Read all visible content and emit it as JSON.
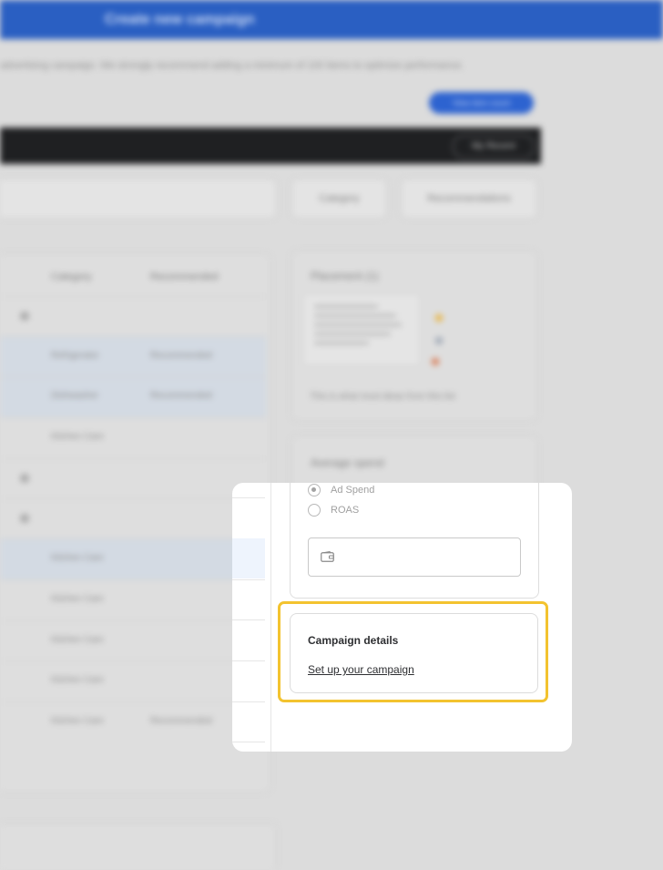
{
  "header": {
    "title": "Create new campaign"
  },
  "intro_text": "advertising campaign. We strongly recommend adding a minimum of 100 items to optimize performance.",
  "help_button": "View item count",
  "toolbar": {
    "button_label": "My Recent"
  },
  "filters": {
    "category": "Category",
    "recommendations": "Recommendations"
  },
  "table": {
    "headers": [
      "Category",
      "Recommended"
    ],
    "rows": [
      {
        "category": "",
        "recommended": "",
        "highlighted": false
      },
      {
        "category": "Refrigerator",
        "recommended": "Recommended",
        "highlighted": true
      },
      {
        "category": "Dishwasher",
        "recommended": "Recommended",
        "highlighted": true
      },
      {
        "category": "Kitchen Care",
        "recommended": "",
        "highlighted": false
      },
      {
        "category": "",
        "recommended": "",
        "highlighted": false
      },
      {
        "category": "",
        "recommended": "",
        "highlighted": false
      },
      {
        "category": "Kitchen Care",
        "recommended": "",
        "highlighted": true
      },
      {
        "category": "Kitchen Care",
        "recommended": "",
        "highlighted": false
      },
      {
        "category": "Kitchen Care",
        "recommended": "",
        "highlighted": false
      },
      {
        "category": "Kitchen Care",
        "recommended": "",
        "highlighted": false
      },
      {
        "category": "Kitchen Care",
        "recommended": "Recommended",
        "highlighted": false
      }
    ]
  },
  "preview_card": {
    "title": "Placement (1)",
    "caption": "This is what most ideas from this list"
  },
  "spend_card": {
    "title": "Average spend",
    "options": [
      {
        "label": "Ad Spend",
        "checked": true
      },
      {
        "label": "ROAS",
        "checked": false
      }
    ],
    "input_value": ""
  },
  "campaign_details": {
    "title": "Campaign details",
    "link": "Set up your campaign"
  },
  "colors": {
    "header_blue": "#2a5fc2",
    "highlight_yellow": "#f3c32f"
  }
}
